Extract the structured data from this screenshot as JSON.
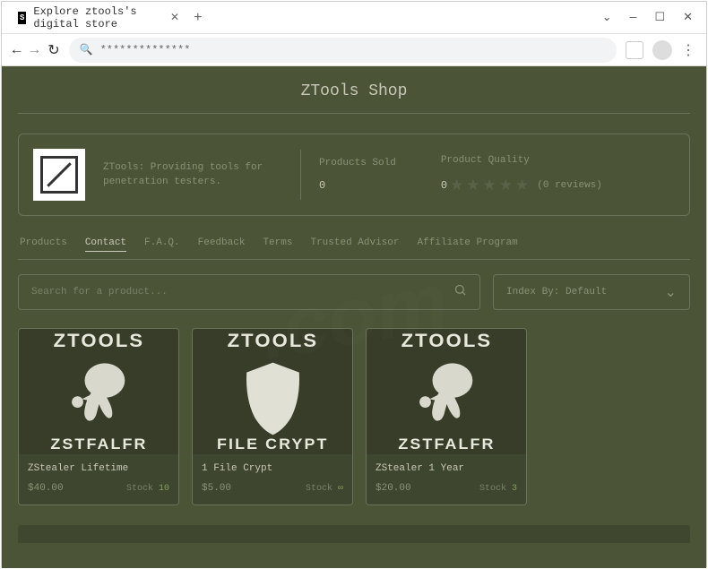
{
  "browser": {
    "tab_title": "Explore ztools's digital store",
    "address": "**************"
  },
  "shop": {
    "title": "ZTools Shop",
    "tagline": "ZTools: Providing tools for penetration testers.",
    "stats": {
      "sold_label": "Products Sold",
      "sold_value": "0",
      "quality_label": "Product Quality",
      "rating": "0",
      "reviews": "(0 reviews)"
    }
  },
  "tabs": [
    "Products",
    "Contact",
    "F.A.Q.",
    "Feedback",
    "Terms",
    "Trusted Advisor",
    "Affiliate Program"
  ],
  "search": {
    "placeholder": "Search for a product..."
  },
  "sort": {
    "label": "Index By: Default"
  },
  "products": [
    {
      "brand_top": "ZTOOLS",
      "brand_bot": "ZSTFALFR",
      "title": "ZStealer Lifetime",
      "price": "$40.00",
      "stock_label": "Stock ",
      "stock_val": "10",
      "icon": "brain"
    },
    {
      "brand_top": "ZTOOLS",
      "brand_bot": "FILE CRYPT",
      "title": "1 File Crypt",
      "price": "$5.00",
      "stock_label": "Stock ",
      "stock_val": "∞",
      "icon": "shield"
    },
    {
      "brand_top": "ZTOOLS",
      "brand_bot": "ZSTFALFR",
      "title": "ZStealer 1 Year",
      "price": "$20.00",
      "stock_label": "Stock ",
      "stock_val": "3",
      "icon": "brain"
    }
  ]
}
